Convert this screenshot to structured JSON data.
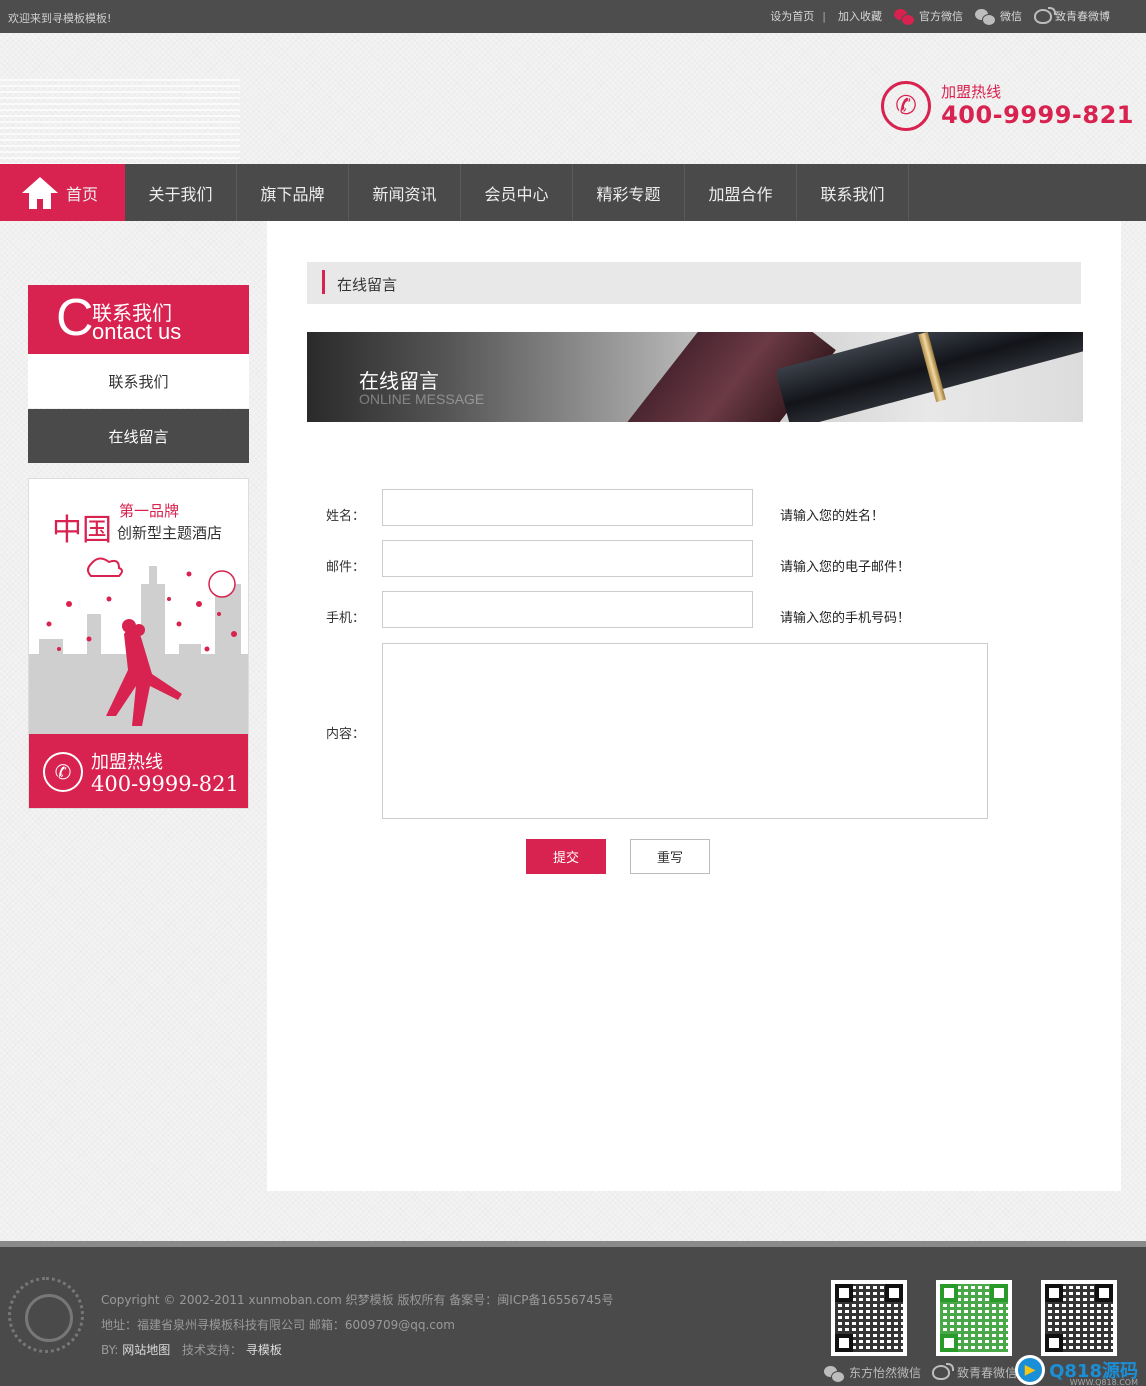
{
  "topbar": {
    "welcome": "欢迎来到寻模板模板!",
    "set_home": "设为首页",
    "separator": "|",
    "favorite": "加入收藏",
    "official_wechat": "官方微信",
    "wechat": "微信",
    "weibo": "致青春微博"
  },
  "header": {
    "hotline_label": "加盟热线",
    "hotline_number": "400-9999-821"
  },
  "nav": {
    "items": [
      "首页",
      "关于我们",
      "旗下品牌",
      "新闻资讯",
      "会员中心",
      "精彩专题",
      "加盟合作",
      "联系我们"
    ]
  },
  "sidebar": {
    "head_big_letter": "C",
    "head_cn": "联系我们",
    "head_en": "ontact us",
    "items": [
      "联系我们",
      "在线留言"
    ]
  },
  "promo": {
    "zh": "中国",
    "tag1": "第一品牌",
    "tag2": "创新型主题酒店",
    "hotline_label": "加盟热线",
    "hotline_number": "400-9999-821"
  },
  "main": {
    "breadcrumb": "在线留言",
    "banner_title": "在线留言",
    "banner_subtitle": "ONLINE MESSAGE",
    "form": {
      "name_label": "姓名：",
      "name_hint": "请输入您的姓名！",
      "email_label": "邮件：",
      "email_hint": "请输入您的电子邮件！",
      "phone_label": "手机：",
      "phone_hint": "请输入您的手机号码！",
      "content_label": "内容：",
      "submit": "提交",
      "reset": "重写"
    }
  },
  "footer": {
    "copyright": "Copyright © 2002-2011 xunmoban.com 织梦模板 版权所有 备案号：闽ICP备16556745号",
    "address": "地址：福建省泉州寻模板科技有限公司 邮箱：6009709@qq.com",
    "by_label": "BY:",
    "sitemap": "网站地图",
    "support_label": "技术支持：",
    "support_name": "寻模板",
    "qr_wechat_label": "东方怡然微信",
    "qr_weibo_label": "致青春微信",
    "watermark_text": "Q818源码",
    "watermark_url": "WWW.Q818.COM"
  },
  "colors": {
    "accent": "#d8224f",
    "dark": "#4a4a4a"
  }
}
